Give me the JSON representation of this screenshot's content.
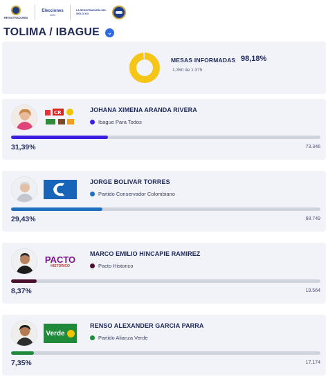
{
  "header": {
    "registraduria_text": "REGISTRADURÍA",
    "elecciones_text": "Elecciones",
    "elecciones_sub": "2023",
    "segundo_text": "LA REGISTRADURÍA DEL SIGLO XXI"
  },
  "location": {
    "title": "TOLIMA / IBAGUE"
  },
  "summary": {
    "mesas_label": "MESAS INFORMADAS",
    "mesas_pct": "98,18%",
    "mesas_pct_value": 98.18,
    "mesas_count": "1.350  de  1.375",
    "donut_color": "#f5c518"
  },
  "candidates": [
    {
      "name": "JOHANA XIMENA ARANDA RIVERA",
      "party": "Ibague Para Todos",
      "color": "#3b1de0",
      "pct": "31,39%",
      "pct_value": 31.39,
      "votes": "73.346",
      "logo": "coalition-logos"
    },
    {
      "name": "JORGE BOLIVAR TORRES",
      "party": "Partido Conservador Colombiano",
      "color": "#1f6fbf",
      "pct": "29,43%",
      "pct_value": 29.43,
      "votes": "68.749",
      "logo": "conservador-logo"
    },
    {
      "name": "MARCO EMILIO HINCAPIE RAMIREZ",
      "party": "Pacto Historico",
      "color": "#4a0f2e",
      "pct": "8,37%",
      "pct_value": 8.37,
      "votes": "19.564",
      "logo": "pacto-historico-logo"
    },
    {
      "name": "RENSO ALEXANDER GARCIA PARRA",
      "party": "Partido Alianza Verde",
      "color": "#1e8a3a",
      "pct": "7,35%",
      "pct_value": 7.35,
      "votes": "17.174",
      "logo": "alianza-verde-logo"
    }
  ],
  "logos": {
    "pacto_text": "PACTO",
    "pacto_sub": "HISTÓRICO",
    "verde_text": "Verde"
  }
}
